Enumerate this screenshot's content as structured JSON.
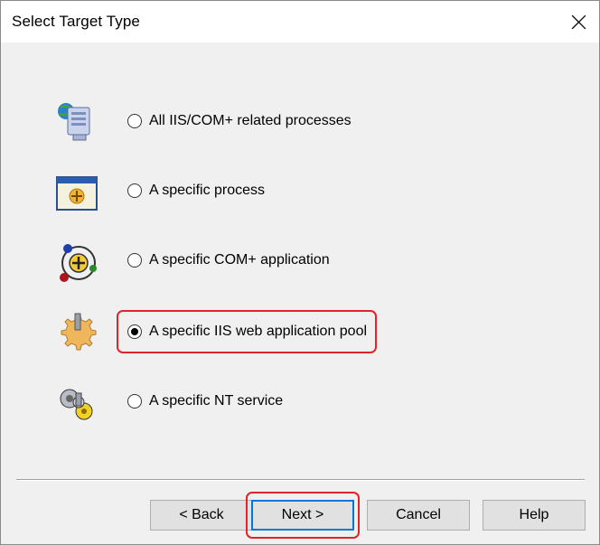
{
  "window": {
    "title": "Select Target Type"
  },
  "options": [
    {
      "label": "All IIS/COM+ related processes",
      "icon": "computer-icon",
      "selected": false
    },
    {
      "label": "A specific process",
      "icon": "process-window-icon",
      "selected": false
    },
    {
      "label": "A specific COM+ application",
      "icon": "com-plus-application-icon",
      "selected": false
    },
    {
      "label": "A specific IIS web application pool",
      "icon": "gear-app-pool-icon",
      "selected": true
    },
    {
      "label": "A specific NT service",
      "icon": "nt-service-gears-icon",
      "selected": false
    }
  ],
  "buttons": {
    "back": "< Back",
    "next": "Next >",
    "cancel": "Cancel",
    "help": "Help"
  },
  "colors": {
    "highlight": "#e0242c",
    "default_button_border": "#0078d7",
    "dialog_background": "#f0f0f0"
  }
}
